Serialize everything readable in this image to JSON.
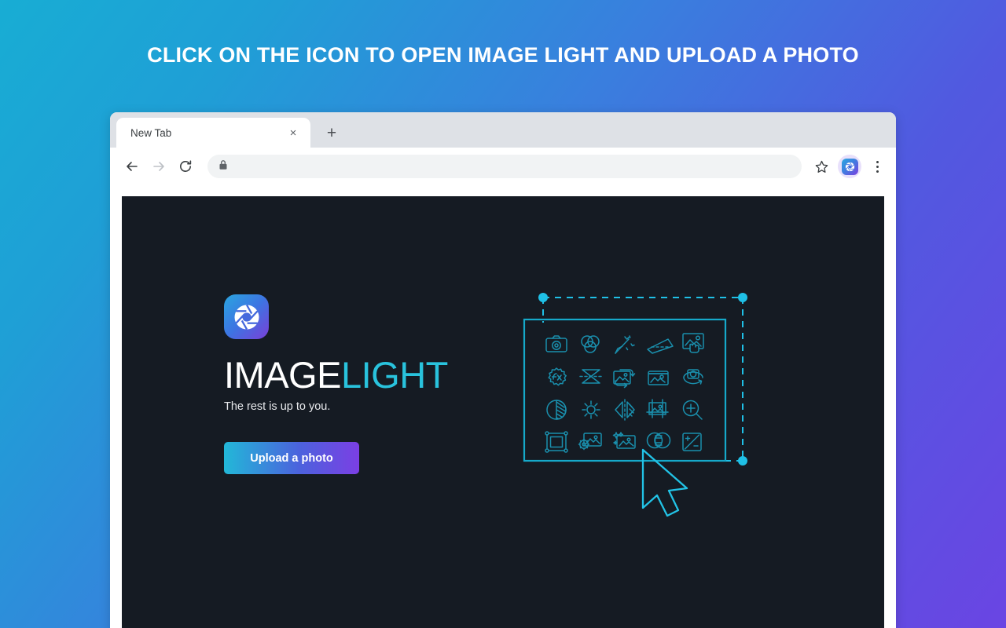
{
  "headline": "CLICK ON THE ICON TO OPEN IMAGE LIGHT AND UPLOAD A PHOTO",
  "browser": {
    "tab": {
      "title": "New Tab",
      "close_label": "×",
      "close_icon": "close-icon"
    },
    "new_tab_label": "+",
    "toolbar": {
      "back_icon": "arrow-left-icon",
      "forward_icon": "arrow-right-icon",
      "reload_icon": "reload-icon",
      "lock_icon": "lock-icon",
      "url_value": "",
      "url_placeholder": "",
      "bookmark_icon": "star-icon",
      "extension_icon": "imagelight-extension-icon",
      "menu_icon": "three-dot-menu-icon"
    }
  },
  "app": {
    "logo_icon": "camera-shutter-icon",
    "wordmark_primary": "IMAGE",
    "wordmark_secondary": "LIGHT",
    "tagline": "The rest is up to you.",
    "upload_button": "Upload a photo",
    "illustration": {
      "cursor_icon": "mouse-cursor-icon",
      "selection_handles": 3,
      "icon_grid": [
        [
          "camera-icon",
          "color-channels-icon",
          "magic-wand-icon",
          "perspective-skew-icon",
          "touch-image-icon"
        ],
        [
          "fx-badge-icon",
          "flip-vertical-icon",
          "image-rotate-icon",
          "photo-album-icon",
          "camera-rotate-icon"
        ],
        [
          "contrast-icon",
          "brightness-icon",
          "mirror-horizontal-icon",
          "crop-image-icon",
          "zoom-in-icon"
        ],
        [
          "frame-border-icon",
          "image-settings-icon",
          "image-enhance-icon",
          "blend-opacity-icon",
          "exposure-icon"
        ]
      ]
    }
  },
  "colors": {
    "bg_start": "#18add4",
    "bg_end": "#6a45e3",
    "app_bg": "#151b23",
    "accent_cyan": "#29c3dd",
    "illustration_line": "#18a5c4",
    "selection_cyan": "#22c3e6"
  }
}
